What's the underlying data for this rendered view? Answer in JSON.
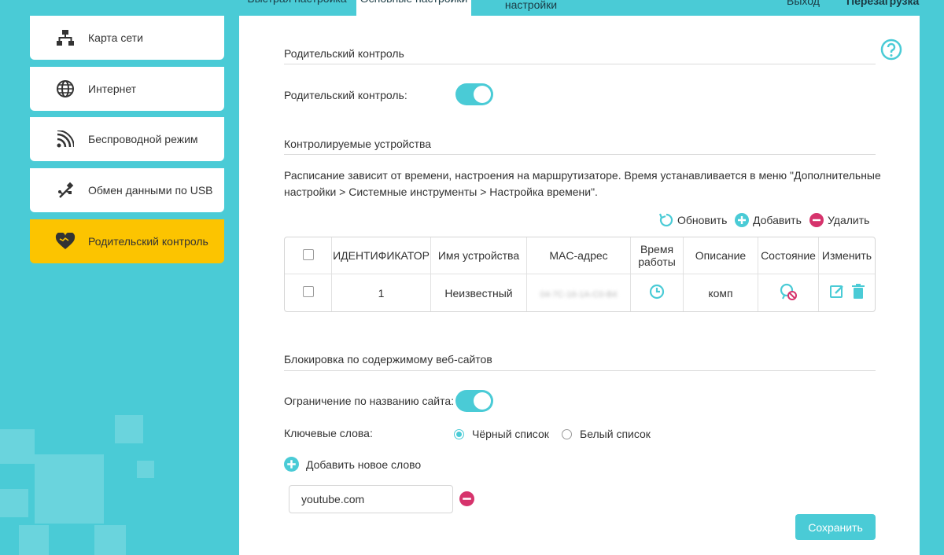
{
  "top_tabs": [
    {
      "label": "Быстрая настройка"
    },
    {
      "label": "Основные настройки"
    },
    {
      "label": "настройки"
    }
  ],
  "top_links": {
    "logout": "Выход",
    "reboot": "Перезагрузка"
  },
  "sidebar": {
    "items": [
      {
        "label": "Карта сети",
        "icon": "network-map-icon"
      },
      {
        "label": "Интернет",
        "icon": "globe-icon"
      },
      {
        "label": "Беспроводной режим",
        "icon": "wireless-icon"
      },
      {
        "label": "Обмен данными по USB",
        "icon": "usb-icon"
      },
      {
        "label": "Родительский контроль",
        "icon": "heart-icon",
        "active": true
      }
    ]
  },
  "parental": {
    "section_title": "Родительский контроль",
    "toggle_label": "Родительский контроль:",
    "enabled": true
  },
  "devices": {
    "section_title": "Контролируемые устройства",
    "note": "Расписание зависит от времени, настроения на маршрутизаторе. Время устанавливается в меню \"Дополнительные настройки > Системные инструменты > Настройка времени\".",
    "actions": {
      "refresh": "Обновить",
      "add": "Добавить",
      "delete": "Удалить"
    },
    "columns": [
      "ИДЕНТИФИКАТОР",
      "Имя устройства",
      "MAC-адрес",
      "Время работы",
      "Описание",
      "Состояние",
      "Изменить"
    ],
    "rows": [
      {
        "id": "1",
        "name": "Неизвестный",
        "mac": "04-7C-16-1A-C0-B4",
        "description": "комп"
      }
    ]
  },
  "website_block": {
    "section_title": "Блокировка по содержимому веб-сайтов",
    "restriction_label": "Ограничение по названию сайта:",
    "restriction_enabled": true,
    "keywords_label": "Ключевые слова:",
    "blacklist_label": "Чёрный список",
    "whitelist_label": "Белый список",
    "selected_mode": "blacklist",
    "add_word_label": "Добавить новое слово",
    "keyword_value": "youtube.com"
  },
  "save_label": "Сохранить",
  "colors": {
    "accent": "#4acbd6",
    "active_nav": "#fcc400",
    "delete": "#d6336c"
  }
}
